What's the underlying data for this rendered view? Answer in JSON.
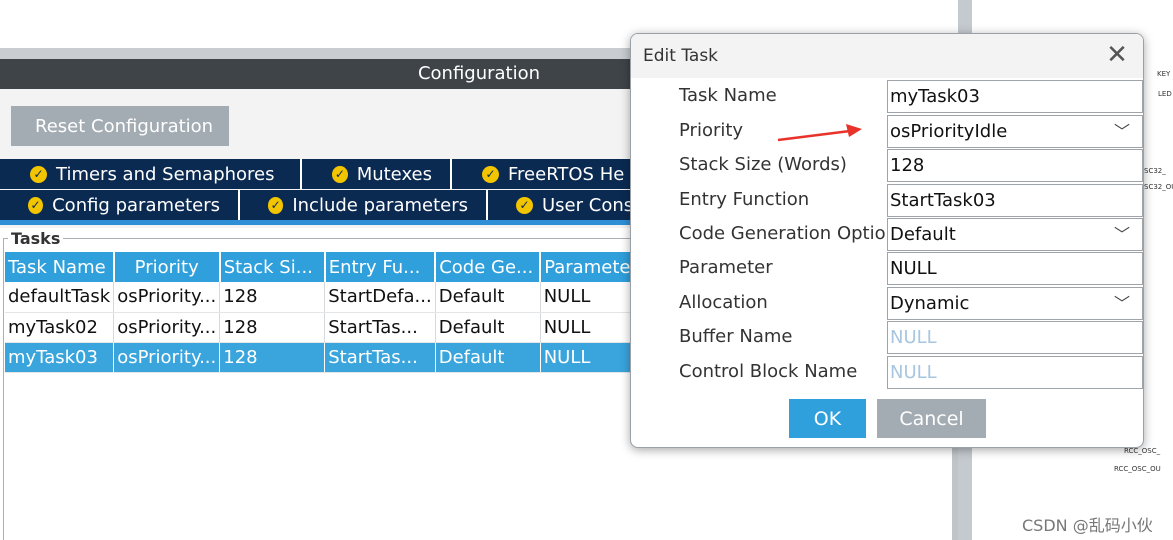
{
  "config": {
    "title": "Configuration",
    "reset_label": "Reset Configuration"
  },
  "tabs_row1": [
    {
      "label": "Timers and Semaphores"
    },
    {
      "label": "Mutexes"
    },
    {
      "label": "FreeRTOS He"
    }
  ],
  "tabs_row2": [
    {
      "label": "Config parameters"
    },
    {
      "label": "Include parameters"
    },
    {
      "label": "User Cons"
    }
  ],
  "tasks": {
    "section_label": "Tasks",
    "columns": [
      "Task Name",
      "Priority",
      "Stack Si...",
      "Entry Fu...",
      "Code Ge...",
      "Parameter"
    ],
    "rows": [
      [
        "defaultTask",
        "osPriority...",
        "128",
        "StartDefa...",
        "Default",
        "NULL"
      ],
      [
        "myTask02",
        "osPriority...",
        "128",
        "StartTas...",
        "Default",
        "NULL"
      ],
      [
        "myTask03",
        "osPriority...",
        "128",
        "StartTas...",
        "Default",
        "NULL"
      ]
    ],
    "selected_row": 2
  },
  "dialog": {
    "title": "Edit Task",
    "close_glyph": "✕",
    "fields": {
      "task_name": {
        "label": "Task Name",
        "value": "myTask03"
      },
      "priority": {
        "label": "Priority",
        "value": "osPriorityIdle"
      },
      "stack_size": {
        "label": "Stack Size (Words)",
        "value": "128"
      },
      "entry_function": {
        "label": "Entry Function",
        "value": "StartTask03"
      },
      "code_generation": {
        "label": "Code Generation Option",
        "value": "Default"
      },
      "parameter": {
        "label": "Parameter",
        "value": "NULL"
      },
      "allocation": {
        "label": "Allocation",
        "value": "Dynamic"
      },
      "buffer_name": {
        "label": "Buffer Name",
        "placeholder": "NULL"
      },
      "control_block_name": {
        "label": "Control Block Name",
        "placeholder": "NULL"
      }
    },
    "ok_label": "OK",
    "cancel_label": "Cancel"
  },
  "pinout_labels": [
    "KEY",
    "LED",
    "SC32_",
    "SC32_OU",
    "RCC_OSC_",
    "RCC_OSC_OU"
  ],
  "watermark": "CSDN @乱码小伙",
  "colors": {
    "dark_bar": "#3f4448",
    "tab_navy": "#0b2a52",
    "accent_blue": "#2fa0dc",
    "check_yellow": "#f2c500",
    "annotation_arrow": "#e8322a"
  }
}
